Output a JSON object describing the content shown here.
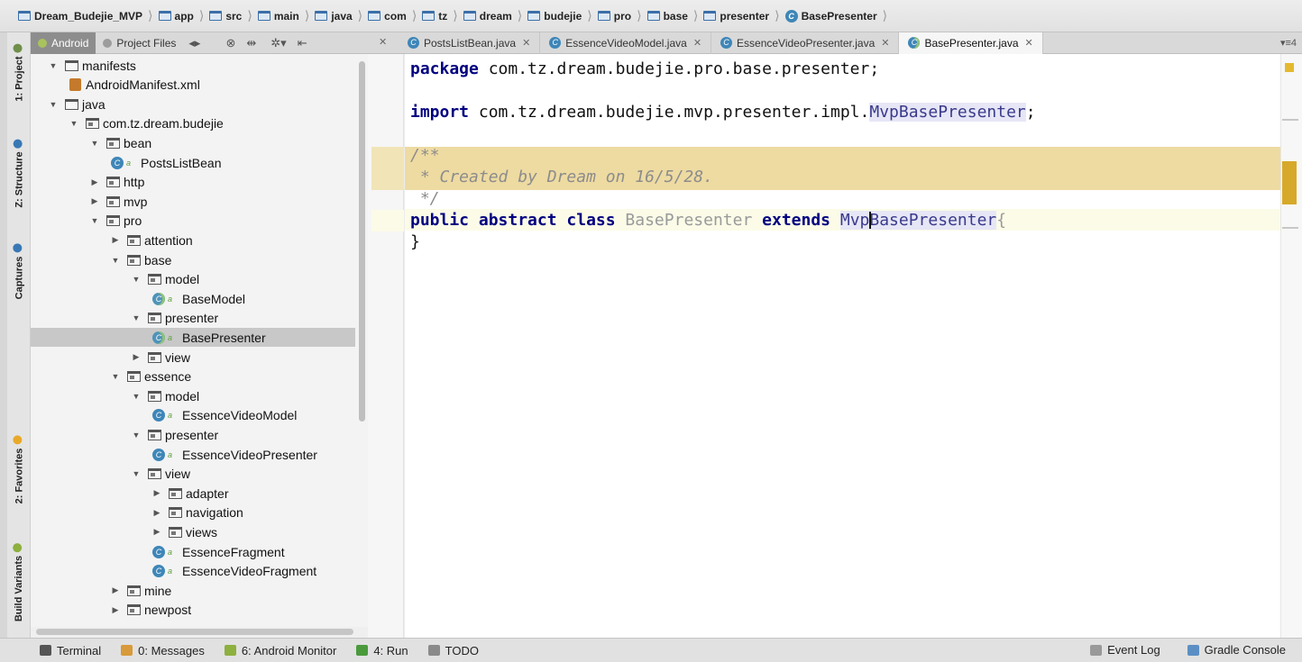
{
  "breadcrumb": [
    {
      "label": "Dream_Budejie_MVP",
      "icon": "module-folder-icon"
    },
    {
      "label": "app",
      "icon": "folder-icon"
    },
    {
      "label": "src",
      "icon": "folder-icon"
    },
    {
      "label": "main",
      "icon": "folder-icon"
    },
    {
      "label": "java",
      "icon": "folder-icon"
    },
    {
      "label": "com",
      "icon": "package-icon"
    },
    {
      "label": "tz",
      "icon": "package-icon"
    },
    {
      "label": "dream",
      "icon": "package-icon"
    },
    {
      "label": "budejie",
      "icon": "package-icon"
    },
    {
      "label": "pro",
      "icon": "package-icon"
    },
    {
      "label": "base",
      "icon": "package-icon"
    },
    {
      "label": "presenter",
      "icon": "package-icon"
    },
    {
      "label": "BasePresenter",
      "icon": "class-icon"
    }
  ],
  "side_tools": {
    "project": "1: Project",
    "structure": "Z: Structure",
    "captures": "Captures",
    "favorites": "2: Favorites",
    "build_variants": "Build Variants"
  },
  "project_panel": {
    "tabs": [
      "Android",
      "Project Files"
    ],
    "active_tab": "Android"
  },
  "editor_tabs": [
    {
      "label": "PostsListBean.java",
      "active": false
    },
    {
      "label": "EssenceVideoModel.java",
      "active": false
    },
    {
      "label": "EssenceVideoPresenter.java",
      "active": false
    },
    {
      "label": "BasePresenter.java",
      "active": true
    }
  ],
  "tree": [
    {
      "label": "manifests",
      "type": "folder",
      "depth": 0,
      "expanded": true
    },
    {
      "label": "AndroidManifest.xml",
      "type": "xml",
      "depth": 1
    },
    {
      "label": "java",
      "type": "folder",
      "depth": 0,
      "expanded": true
    },
    {
      "label": "com.tz.dream.budejie",
      "type": "package",
      "depth": 1,
      "expanded": true
    },
    {
      "label": "bean",
      "type": "package",
      "depth": 2,
      "expanded": true
    },
    {
      "label": "PostsListBean",
      "type": "class",
      "depth": 3
    },
    {
      "label": "http",
      "type": "package",
      "depth": 2,
      "expanded": false
    },
    {
      "label": "mvp",
      "type": "package",
      "depth": 2,
      "expanded": false
    },
    {
      "label": "pro",
      "type": "package",
      "depth": 2,
      "expanded": true
    },
    {
      "label": "attention",
      "type": "package",
      "depth": 3,
      "expanded": false
    },
    {
      "label": "base",
      "type": "package",
      "depth": 3,
      "expanded": true
    },
    {
      "label": "model",
      "type": "package",
      "depth": 4,
      "expanded": true
    },
    {
      "label": "BaseModel",
      "type": "abstract",
      "depth": 5
    },
    {
      "label": "presenter",
      "type": "package",
      "depth": 4,
      "expanded": true
    },
    {
      "label": "BasePresenter",
      "type": "abstract",
      "depth": 5,
      "selected": true
    },
    {
      "label": "view",
      "type": "package",
      "depth": 4,
      "expanded": false
    },
    {
      "label": "essence",
      "type": "package",
      "depth": 3,
      "expanded": true
    },
    {
      "label": "model",
      "type": "package",
      "depth": 4,
      "expanded": true
    },
    {
      "label": "EssenceVideoModel",
      "type": "class",
      "depth": 5
    },
    {
      "label": "presenter",
      "type": "package",
      "depth": 4,
      "expanded": true
    },
    {
      "label": "EssenceVideoPresenter",
      "type": "class",
      "depth": 5
    },
    {
      "label": "view",
      "type": "package",
      "depth": 4,
      "expanded": true
    },
    {
      "label": "adapter",
      "type": "package",
      "depth": 5,
      "expanded": false
    },
    {
      "label": "navigation",
      "type": "package",
      "depth": 5,
      "expanded": false
    },
    {
      "label": "views",
      "type": "package",
      "depth": 5,
      "expanded": false
    },
    {
      "label": "EssenceFragment",
      "type": "class",
      "depth": 5
    },
    {
      "label": "EssenceVideoFragment",
      "type": "class",
      "depth": 5
    },
    {
      "label": "mine",
      "type": "package",
      "depth": 3,
      "expanded": false
    },
    {
      "label": "newpost",
      "type": "package",
      "depth": 3,
      "expanded": false
    }
  ],
  "code": {
    "line1_kw": "package",
    "line1_rest": " com.tz.dream.budejie.pro.base.presenter;",
    "line2_kw": "import",
    "line2_rest": " com.tz.dream.budejie.mvp.presenter.impl.",
    "line2_ref": "MvpBasePresenter",
    "line2_end": ";",
    "comment1": "/**",
    "comment2": " * Created by Dream on 16/5/28.",
    "comment3": " */",
    "decl_kw1": "public abstract class",
    "decl_name": "BasePresenter",
    "decl_kw2": "extends",
    "decl_ref_a": "Mvp",
    "decl_ref_b": "BasePresenter",
    "decl_end": "{",
    "close": "}"
  },
  "bottom_tools": [
    {
      "label": "Terminal",
      "icon": "terminal-icon"
    },
    {
      "label": "0: Messages",
      "icon": "messages-icon"
    },
    {
      "label": "6: Android Monitor",
      "icon": "android-icon"
    },
    {
      "label": "4: Run",
      "icon": "run-icon"
    },
    {
      "label": "TODO",
      "icon": "todo-icon"
    }
  ],
  "bottom_right": [
    {
      "label": "Event Log",
      "icon": "event-log-icon"
    },
    {
      "label": "Gradle Console",
      "icon": "gradle-console-icon"
    }
  ],
  "colors": {
    "keyword": "#000080",
    "reference": "#3a3a8c",
    "comment_band": "#eedba2",
    "selection": "#c8c8c8"
  }
}
